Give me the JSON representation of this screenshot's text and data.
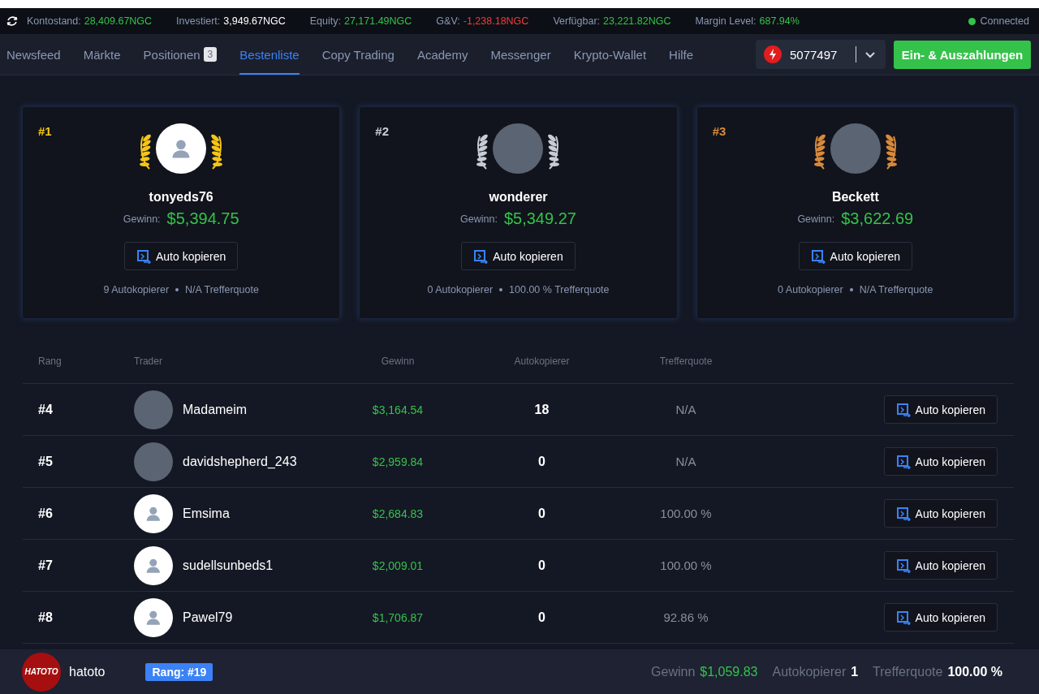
{
  "stats_bar": {
    "items": [
      {
        "label": "Kontostand:",
        "value": "28,409.67NGC",
        "kind": "positive"
      },
      {
        "label": "Investiert:",
        "value": "3,949.67NGC",
        "kind": "neutral"
      },
      {
        "label": "Equity:",
        "value": "27,171.49NGC",
        "kind": "positive"
      },
      {
        "label": "G&V:",
        "value": "-1,238.18NGC",
        "kind": "negative"
      },
      {
        "label": "Verfügbar:",
        "value": "23,221.82NGC",
        "kind": "positive"
      },
      {
        "label": "Margin Level:",
        "value": "687.94%",
        "kind": "positive"
      }
    ],
    "connection": {
      "label": "Connected",
      "connected": true
    }
  },
  "nav": {
    "tabs": [
      {
        "label": "Newsfeed",
        "selected": false
      },
      {
        "label": "Märkte",
        "selected": false
      },
      {
        "label": "Positionen",
        "badge": "3",
        "selected": false
      },
      {
        "label": "Bestenliste",
        "selected": true
      },
      {
        "label": "Copy Trading",
        "selected": false
      },
      {
        "label": "Academy",
        "selected": false
      },
      {
        "label": "Messenger",
        "selected": false
      },
      {
        "label": "Krypto-Wallet",
        "selected": false
      },
      {
        "label": "Hilfe",
        "selected": false
      }
    ],
    "account": {
      "number": "5077497"
    },
    "deposit_button": "Ein- & Auszahlungen"
  },
  "podium": [
    {
      "rank": "#1",
      "color": "#f5c518",
      "avatar": {
        "kind": "default"
      },
      "name": "tonyeds76",
      "profit_label": "Gewinn:",
      "profit": "$5,394.75",
      "button": "Auto kopieren",
      "copiers": "9 Autokopierer",
      "hit_rate": "N/A Trefferquote"
    },
    {
      "rank": "#2",
      "color": "#c8ccd4",
      "avatar": {
        "kind": "photo"
      },
      "name": "wonderer",
      "profit_label": "Gewinn:",
      "profit": "$5,349.27",
      "button": "Auto kopieren",
      "copiers": "0 Autokopierer",
      "hit_rate": "100.00 % Trefferquote"
    },
    {
      "rank": "#3",
      "color": "#d88a3a",
      "avatar": {
        "kind": "photo"
      },
      "name": "Beckett",
      "profit_label": "Gewinn:",
      "profit": "$3,622.69",
      "button": "Auto kopieren",
      "copiers": "0 Autokopierer",
      "hit_rate": "N/A Trefferquote"
    }
  ],
  "table": {
    "columns": [
      "Rang",
      "Trader",
      "Gewinn",
      "Autokopierer",
      "Trefferquote"
    ],
    "rows": [
      {
        "rank": "#4",
        "avatar": {
          "kind": "photo"
        },
        "name": "Madameim",
        "profit": "$3,164.54",
        "copiers": "18",
        "hit_rate": "N/A",
        "button": "Auto kopieren"
      },
      {
        "rank": "#5",
        "avatar": {
          "kind": "photo"
        },
        "name": "davidshepherd_243",
        "profit": "$2,959.84",
        "copiers": "0",
        "hit_rate": "N/A",
        "button": "Auto kopieren"
      },
      {
        "rank": "#6",
        "avatar": {
          "kind": "default"
        },
        "name": "Emsima",
        "profit": "$2,684.83",
        "copiers": "0",
        "hit_rate": "100.00 %",
        "button": "Auto kopieren"
      },
      {
        "rank": "#7",
        "avatar": {
          "kind": "default"
        },
        "name": "sudellsunbeds1",
        "profit": "$2,009.01",
        "copiers": "0",
        "hit_rate": "100.00 %",
        "button": "Auto kopieren"
      },
      {
        "rank": "#8",
        "avatar": {
          "kind": "default"
        },
        "name": "Pawel79",
        "profit": "$1,706.87",
        "copiers": "0",
        "hit_rate": "92.86 %",
        "button": "Auto kopieren"
      }
    ]
  },
  "footer": {
    "avatar_text": "HATOTO",
    "name": "hatoto",
    "rank": "Rang: #19",
    "stats": [
      {
        "label": "Gewinn",
        "value": "$1,059.83",
        "kind": "positive"
      },
      {
        "label": "Autokopierer",
        "value": "1",
        "kind": "neutral"
      },
      {
        "label": "Trefferquote",
        "value": "100.00 %",
        "kind": "neutral"
      }
    ]
  }
}
